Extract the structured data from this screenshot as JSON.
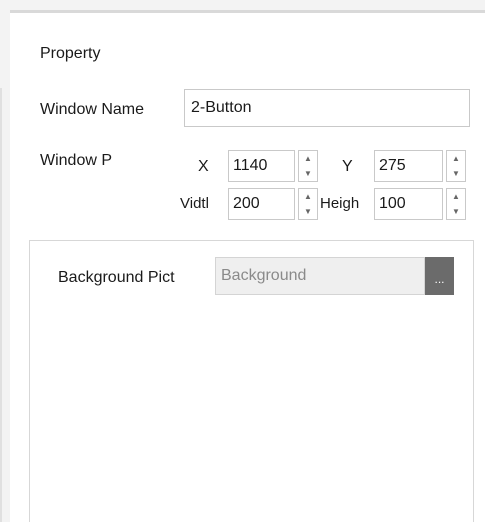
{
  "property_panel": {
    "title": "Property",
    "window_name": {
      "label": "Window Name",
      "value": "2-Button"
    },
    "window_position": {
      "label": "Window P",
      "x": {
        "label": "X",
        "value": "1140"
      },
      "y": {
        "label": "Y",
        "value": "275"
      },
      "width": {
        "label": "Vidtl",
        "value": "200"
      },
      "height": {
        "label": "Heigh",
        "value": "100"
      }
    },
    "background": {
      "label": "Background Pict",
      "placeholder": "Background",
      "browse_label": "..."
    }
  },
  "icons": {
    "spin_up": "spin-up-icon",
    "spin_down": "spin-down-icon"
  },
  "colors": {
    "panel_bg": "#ffffff",
    "outer_bg": "#f3f3f3",
    "border": "#c9c9c9",
    "browse_button": "#6b6b6b",
    "disabled_field": "#efefef"
  }
}
